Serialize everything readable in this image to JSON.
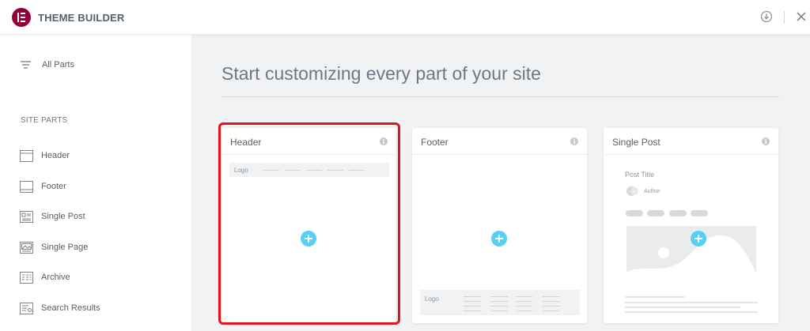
{
  "app": {
    "title": "THEME BUILDER",
    "logo_icon": "elementor-logo-icon",
    "brand_color": "#92003b"
  },
  "topbar": {
    "download_icon": "download-icon",
    "close_icon": "close-icon"
  },
  "sidebar": {
    "all_parts_label": "All Parts",
    "all_parts_icon": "filter-icon",
    "section_title": "SITE PARTS",
    "items": [
      {
        "label": "Header",
        "icon": "header-template-icon"
      },
      {
        "label": "Footer",
        "icon": "footer-template-icon"
      },
      {
        "label": "Single Post",
        "icon": "single-post-icon"
      },
      {
        "label": "Single Page",
        "icon": "single-page-icon"
      },
      {
        "label": "Archive",
        "icon": "archive-icon"
      },
      {
        "label": "Search Results",
        "icon": "search-results-icon"
      }
    ]
  },
  "main": {
    "title": "Start customizing every part of your site",
    "accent_color": "#58d0f5",
    "highlight_color": "#e0151d",
    "cards": [
      {
        "title": "Header",
        "preview_logo": "Logo",
        "highlighted": true
      },
      {
        "title": "Footer",
        "preview_logo": "Logo"
      },
      {
        "title": "Single Post",
        "preview_post_title": "Post Title",
        "preview_author": "Author"
      }
    ]
  }
}
